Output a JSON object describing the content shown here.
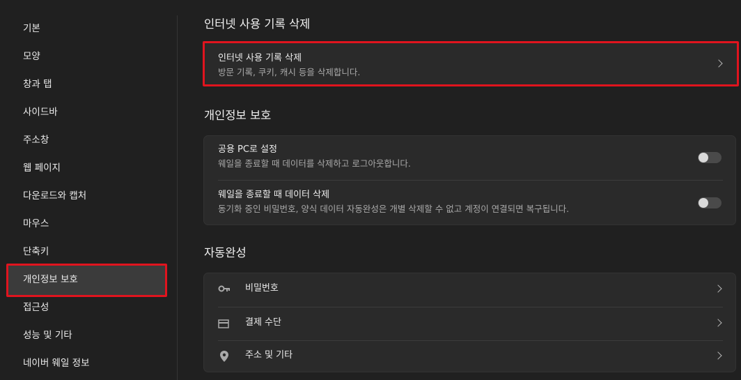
{
  "sidebar": {
    "items": [
      {
        "label": "기본"
      },
      {
        "label": "모양"
      },
      {
        "label": "창과 탭"
      },
      {
        "label": "사이드바"
      },
      {
        "label": "주소창"
      },
      {
        "label": "웹 페이지"
      },
      {
        "label": "다운로드와 캡처"
      },
      {
        "label": "마우스"
      },
      {
        "label": "단축키"
      },
      {
        "label": "개인정보 보호"
      },
      {
        "label": "접근성"
      },
      {
        "label": "성능 및 기타"
      },
      {
        "label": "네이버 웨일 정보"
      }
    ],
    "active_index": 9
  },
  "sections": {
    "history": {
      "title": "인터넷 사용 기록 삭제",
      "row": {
        "title": "인터넷 사용 기록 삭제",
        "desc": "방문 기록, 쿠키, 캐시 등을 삭제합니다."
      }
    },
    "privacy": {
      "title": "개인정보 보호",
      "rows": [
        {
          "title": "공용 PC로 설정",
          "desc": "웨일을 종료할 때 데이터를 삭제하고 로그아웃합니다.",
          "toggle_on": false
        },
        {
          "title": "웨일을 종료할 때 데이터 삭제",
          "desc": "동기화 중인 비밀번호, 양식 데이터 자동완성은 개별 삭제할 수 없고 계정이 연결되면 복구됩니다.",
          "toggle_on": false
        }
      ]
    },
    "autofill": {
      "title": "자동완성",
      "rows": [
        {
          "label": "비밀번호",
          "icon": "key-icon"
        },
        {
          "label": "결제 수단",
          "icon": "credit-card-icon"
        },
        {
          "label": "주소 및 기타",
          "icon": "location-pin-icon"
        }
      ]
    }
  },
  "colors": {
    "highlight": "#e0141e",
    "background": "#202020",
    "card": "#2a2a2a"
  }
}
